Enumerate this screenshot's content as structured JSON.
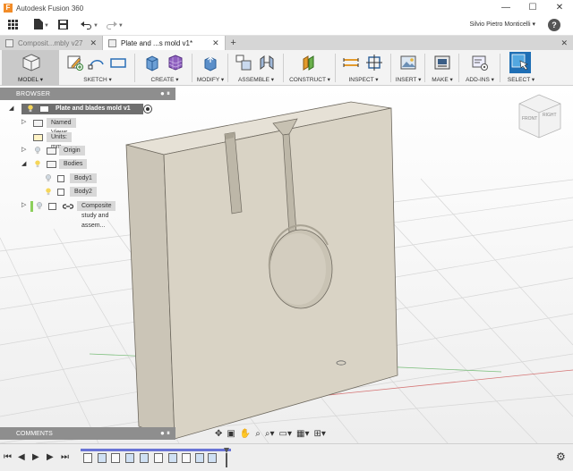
{
  "window": {
    "logo_letter": "F",
    "title": "Autodesk Fusion 360",
    "controls": [
      "—",
      "☐",
      "✕"
    ]
  },
  "quick_access": {
    "user_name": "Silvio Pietro Monticelli ▾",
    "help": "?"
  },
  "tabs": [
    {
      "label": "Composit...mbly v27",
      "active": false
    },
    {
      "label": "Plate and ...s mold v1*",
      "active": true
    }
  ],
  "toolbar": {
    "workspace": "MODEL ▾",
    "groups": [
      "SKETCH ▾",
      "CREATE ▾",
      "MODIFY ▾",
      "ASSEMBLE ▾",
      "CONSTRUCT ▾",
      "INSPECT ▾",
      "INSERT ▾",
      "MAKE ▾",
      "ADD-INS ▾",
      "SELECT ▾"
    ]
  },
  "browser": {
    "title": "BROWSER",
    "root": "Plate and blades mold v1",
    "named_views": "Named Views",
    "units": "Units: mm",
    "origin": "Origin",
    "bodies": "Bodies",
    "body1": "Body1",
    "body2": "Body2",
    "component": "Composite study and assem..."
  },
  "viewcube": {
    "front": "FRONT",
    "right": "RIGHT"
  },
  "comments": {
    "title": "COMMENTS"
  },
  "colors": {
    "toolbar_bg": "#f3f3f3",
    "panel_header": "#8e8e8e",
    "model_face": "#d7d1c3",
    "select_accent": "#1f6fb5"
  }
}
